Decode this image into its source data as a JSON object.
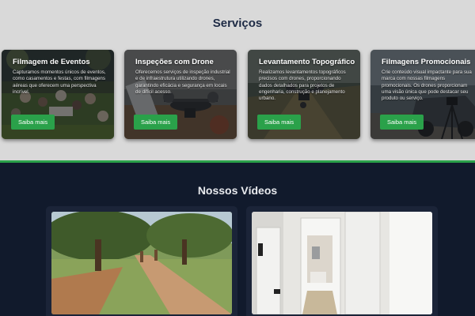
{
  "services": {
    "title": "Serviços",
    "items": [
      {
        "title": "Filmagem de Eventos",
        "description": "Capturamos momentos únicos de eventos, como casamentos e festas, com filmagens aéreas que oferecem uma perspectiva incrível.",
        "button": "Saiba mais",
        "image": "event-crowd-photo"
      },
      {
        "title": "Inspeções com Drone",
        "description": "Oferecemos serviços de inspeção industrial e de infraestrutura utilizando drones, garantindo eficácia e segurança em locais de difícil acesso.",
        "button": "Saiba mais",
        "image": "drone-photo"
      },
      {
        "title": "Levantamento Topográfico",
        "description": "Realizamos levantamentos topográficos precisos com drones, proporcionando dados detalhados para projetos de engenharia, construção e planejamento urbano.",
        "button": "Saiba mais",
        "image": "drone-over-field-photo"
      },
      {
        "title": "Filmagens Promocionais",
        "description": "Crie conteúdo visual impactante para sua marca com nossas filmagens promocionais. Os drones proporcionam uma visão única que pode destacar seu produto ou serviço.",
        "button": "Saiba mais",
        "image": "car-and-tripod-photo"
      }
    ]
  },
  "videos": {
    "title": "Nossos Vídeos",
    "items": [
      {
        "image": "park-path-video-thumbnail"
      },
      {
        "image": "house-interior-video-thumbnail"
      }
    ]
  },
  "colors": {
    "accent_green": "#2aa14a",
    "services_background": "#d9d9d9",
    "dark_background": "#111a2c",
    "heading_navy": "#1e2b45"
  }
}
